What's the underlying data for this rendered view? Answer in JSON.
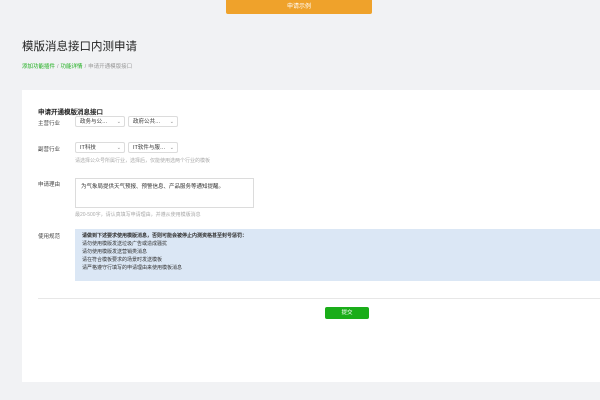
{
  "top_tab": {
    "label": "申请示例"
  },
  "page": {
    "title": "模版消息接口内测申请",
    "breadcrumb": [
      {
        "label": "添加功能插件",
        "link": true
      },
      {
        "label": "功能详情",
        "link": true
      },
      {
        "label": "申请开通模版接口",
        "link": false
      }
    ]
  },
  "form": {
    "section_title": "申请开通模版消息接口",
    "primary_industry": {
      "label": "主营行业",
      "select1": "政务与公…",
      "select2": "政府公共…"
    },
    "secondary_industry": {
      "label": "副营行业",
      "select1": "IT科技",
      "select2": "IT软件与服…",
      "hint": "请选择公众号所属行业，选择后，仅能使用选两个行业的模板"
    },
    "reason": {
      "label": "申请理由",
      "value": "为气象局提供天气预报、预警信息、产品服务等通知提醒。",
      "hint": "最20-500字，请认真填写申请理由，并遵从使用模版消息"
    },
    "notice": {
      "label": "使用规范",
      "header": "请做到下述要求使用模版消息，否则可能会被停止内测资格甚至封号惩罚：",
      "lines": [
        "请勿使用模版发送垃圾广告或造成骚扰",
        "请勿使用模版发送营销类消息",
        "请在符合模板要求的场景时发送模板",
        "请严格遵守行填写的申请理由来使用模板消息"
      ]
    },
    "submit_label": "提交"
  },
  "colors": {
    "accent_green": "#1aad19",
    "tab_orange": "#efa22b",
    "notice_bg": "#dbe7f5"
  }
}
